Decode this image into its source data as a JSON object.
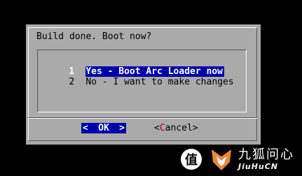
{
  "dialog": {
    "title": "Build done. Boot now?",
    "menu": [
      {
        "tag": "1",
        "label": "Yes - Boot Arc Loader now",
        "selected": true
      },
      {
        "tag": "2",
        "label": "No - I want to make changes",
        "selected": false
      }
    ],
    "buttons": {
      "ok": {
        "left_arrow": "<",
        "label": "OK",
        "right_arrow": ">"
      },
      "cancel": {
        "open": "<",
        "hotkey": "C",
        "rest": "ancel",
        "close": ">"
      }
    }
  },
  "colors": {
    "screen_bg": "#000000",
    "dialog_bg": "#aaaaaa",
    "highlight": "#0000aa",
    "highlight_text": "#ffffff",
    "hotkey": "#aa0000"
  },
  "watermark": {
    "badge": "值",
    "name_cn": "九狐问心",
    "name_en": "JiuHuCN"
  }
}
